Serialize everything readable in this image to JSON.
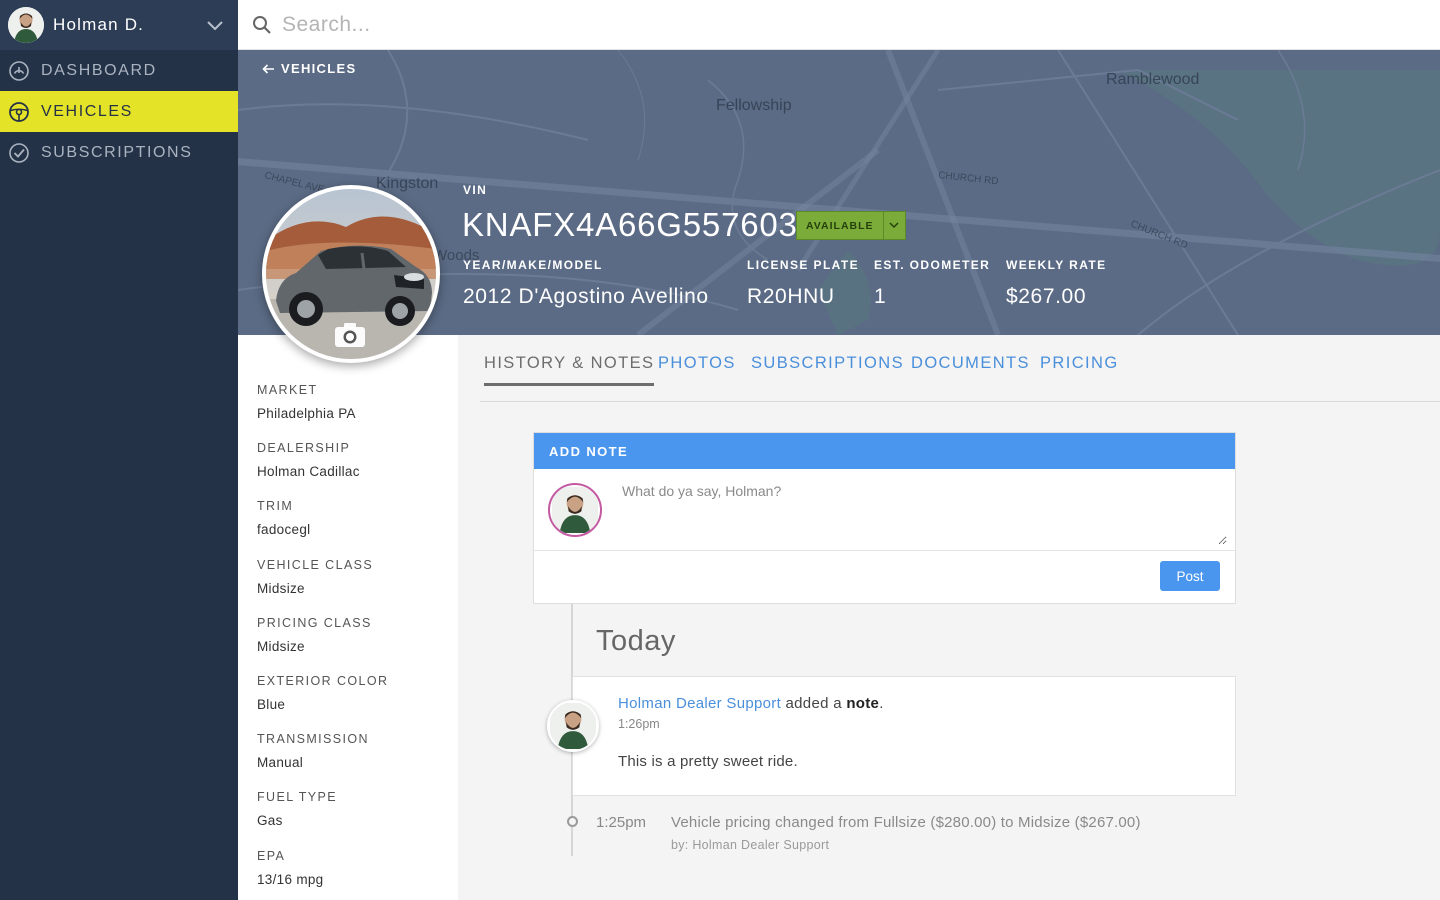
{
  "user": {
    "name": "Holman D."
  },
  "nav": [
    {
      "label": "DASHBOARD",
      "icon": "gauge-icon"
    },
    {
      "label": "VEHICLES",
      "icon": "steering-wheel-icon",
      "active": true
    },
    {
      "label": "SUBSCRIPTIONS",
      "icon": "check-circle-icon"
    }
  ],
  "search": {
    "placeholder": "Search..."
  },
  "header": {
    "back_label": "VEHICLES",
    "vin_label": "VIN",
    "vin": "KNAFX4A66G5576038",
    "status": "AVAILABLE",
    "fields": [
      {
        "label": "YEAR/MAKE/MODEL",
        "value": "2012 D'Agostino Avellino"
      },
      {
        "label": "LICENSE PLATE",
        "value": "R20HNU"
      },
      {
        "label": "EST. ODOMETER",
        "value": "1"
      },
      {
        "label": "WEEKLY RATE",
        "value": "$267.00"
      }
    ],
    "map_labels": [
      "Fellowship",
      "Ramblewood",
      "Kingston",
      "Woods",
      "CHURCH RD",
      "CHURCH RD",
      "CHAPEL AVE"
    ]
  },
  "details": [
    {
      "label": "MARKET",
      "value": "Philadelphia PA"
    },
    {
      "label": "DEALERSHIP",
      "value": "Holman Cadillac"
    },
    {
      "label": "TRIM",
      "value": "fadocegl"
    },
    {
      "label": "VEHICLE CLASS",
      "value": "Midsize"
    },
    {
      "label": "PRICING CLASS",
      "value": "Midsize"
    },
    {
      "label": "EXTERIOR COLOR",
      "value": "Blue"
    },
    {
      "label": "TRANSMISSION",
      "value": "Manual"
    },
    {
      "label": "FUEL TYPE",
      "value": "Gas"
    },
    {
      "label": "EPA",
      "value": "13/16 mpg"
    }
  ],
  "tabs": [
    {
      "label": "HISTORY & NOTES",
      "active": true
    },
    {
      "label": "PHOTOS"
    },
    {
      "label": "SUBSCRIPTIONS"
    },
    {
      "label": "DOCUMENTS"
    },
    {
      "label": "PRICING"
    }
  ],
  "note": {
    "title": "ADD NOTE",
    "placeholder": "What do ya say, Holman?",
    "post_label": "Post"
  },
  "timeline": {
    "day": "Today",
    "entry": {
      "author": "Holman Dealer Support",
      "action": " added a ",
      "kind": "note",
      "end": ".",
      "time": "1:26pm",
      "text": "This is a pretty sweet ride."
    },
    "event": {
      "time": "1:25pm",
      "text": "Vehicle pricing changed from Fullsize ($280.00) to Midsize ($267.00)",
      "by": "by: Holman Dealer Support"
    }
  },
  "colors": {
    "sidebar": "#243247",
    "active_nav": "#e5e327",
    "accent": "#4a96ee",
    "status": "#7bac3a",
    "map": "#5b6b85"
  }
}
